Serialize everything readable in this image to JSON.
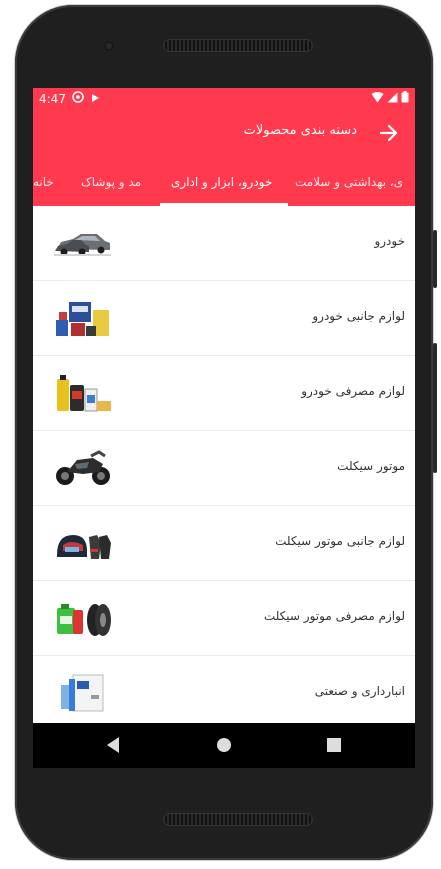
{
  "status_bar": {
    "time": "4:47",
    "left_icons": [
      "sync-icon",
      "play-icon"
    ],
    "right_icons": [
      "wifi-icon",
      "signal-icon",
      "battery-icon"
    ]
  },
  "app_bar": {
    "title": "دسته بندی محصولات",
    "back_icon": "arrow-right-icon"
  },
  "tabs": [
    {
      "label": "خانه",
      "active": false
    },
    {
      "label": "مد و پوشاک",
      "active": false
    },
    {
      "label": "خودرو، ابزار و اداری",
      "active": true
    },
    {
      "label": "ی، بهداشتی و سلامت",
      "active": false
    }
  ],
  "categories": [
    {
      "label": "خودرو",
      "icon": "car-icon"
    },
    {
      "label": "لوازم جانبی خودرو",
      "icon": "car-accessories-icon"
    },
    {
      "label": "لوازم مصرفی خودرو",
      "icon": "car-consumables-icon"
    },
    {
      "label": "موتور سیکلت",
      "icon": "motorcycle-icon"
    },
    {
      "label": "لوازم جانبی موتور سیکلت",
      "icon": "motorcycle-accessories-icon"
    },
    {
      "label": "لوازم مصرفی موتور سیکلت",
      "icon": "motorcycle-consumables-icon"
    },
    {
      "label": "انبارداری و صنعتی",
      "icon": "industrial-icon"
    }
  ],
  "nav_bar": {
    "back": "nav-back-icon",
    "home": "nav-home-icon",
    "recents": "nav-recents-icon"
  },
  "colors": {
    "primary": "#ff3a4f",
    "frame": "#1f1f1f"
  }
}
